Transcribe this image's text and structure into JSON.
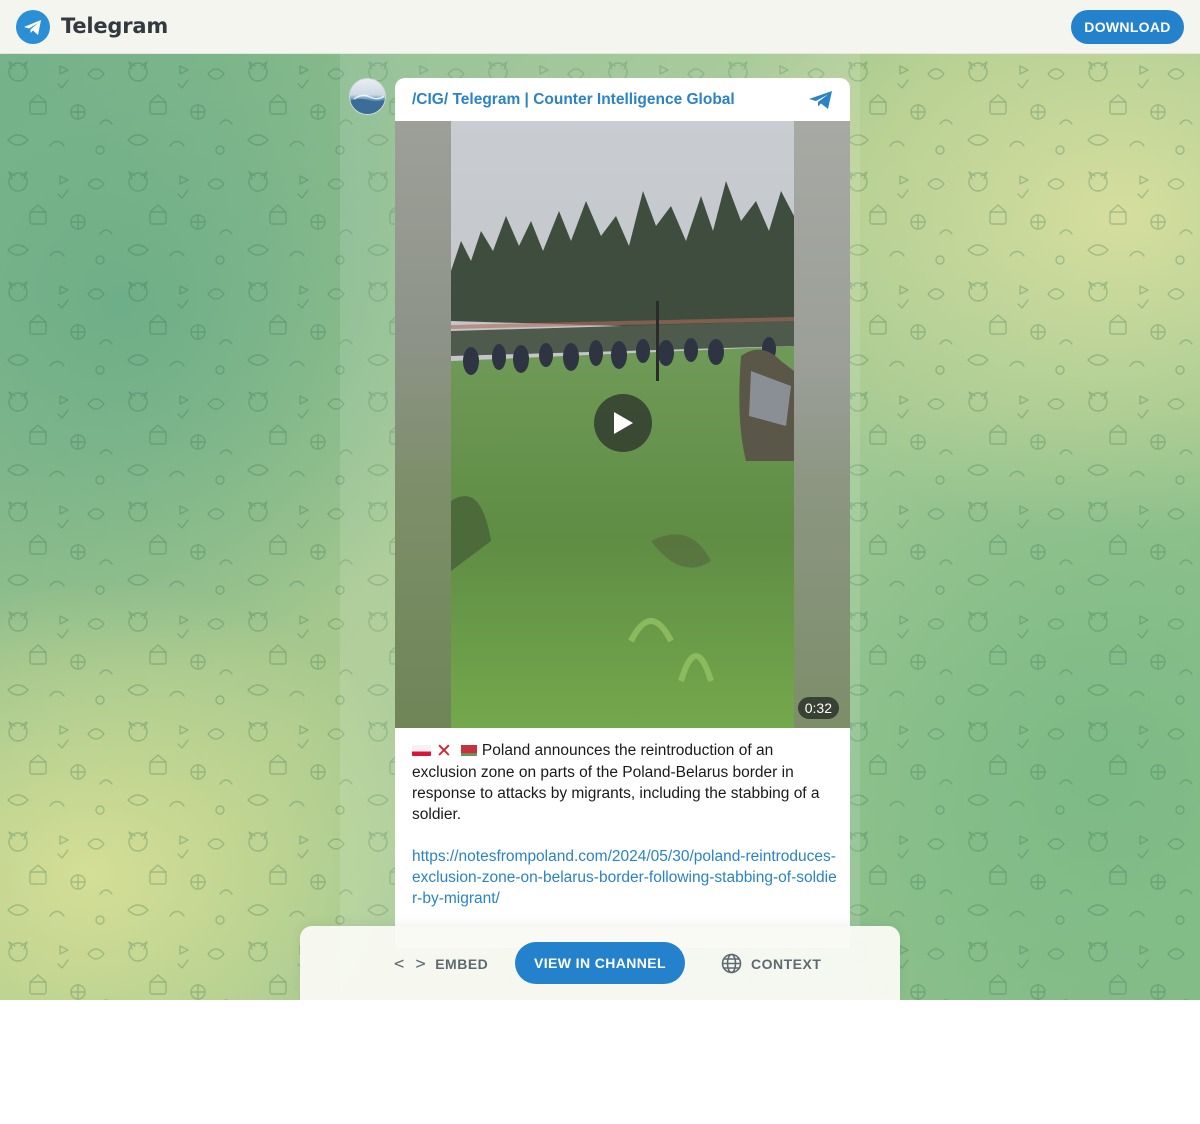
{
  "header": {
    "brand": "Telegram",
    "download_label": "DOWNLOAD"
  },
  "post": {
    "channel_name": "/CIG/ Telegram | Counter Intelligence Global",
    "video_duration": "0:32",
    "caption_text": "Poland announces the reintroduction of an exclusion zone on parts of the Poland-Belarus border in response to attacks by migrants, including the stabbing of a soldier.",
    "link": "https://notesfrompoland.com/2024/05/30/poland-reintroduces-exclusion-zone-on-belarus-border-following-stabbing-of-soldier-by-migrant/"
  },
  "actions": {
    "embed_label": "EMBED",
    "view_label": "VIEW IN CHANNEL",
    "context_label": "CONTEXT"
  },
  "colors": {
    "accent": "#2481cc",
    "link": "#2a83c4"
  }
}
